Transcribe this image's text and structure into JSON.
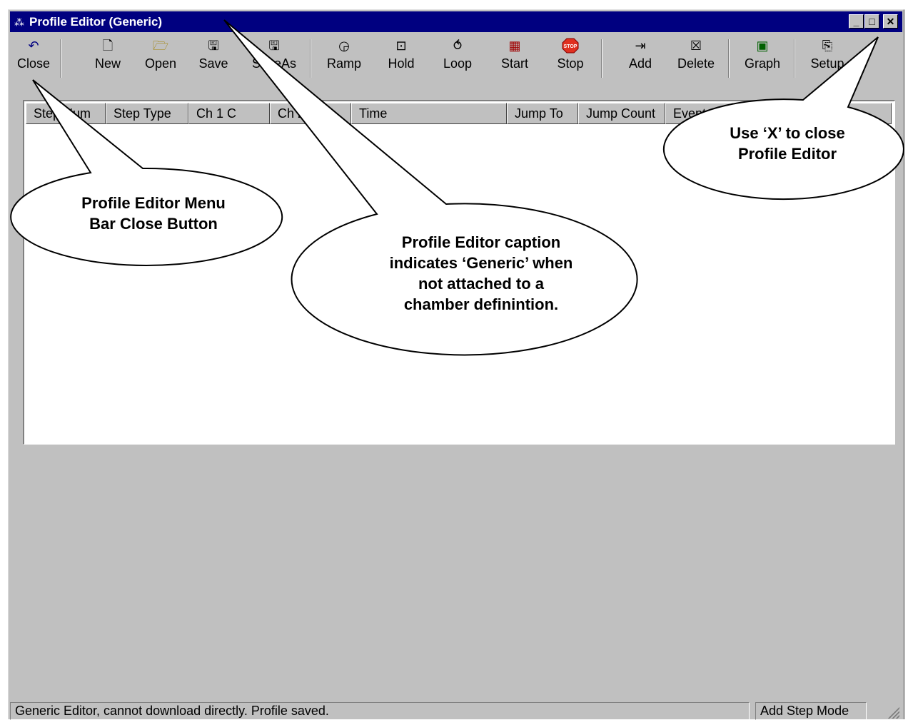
{
  "window": {
    "title": "Profile Editor (Generic)",
    "minimize_glyph": "_",
    "maximize_glyph": "□",
    "close_glyph": "✕"
  },
  "toolbar": {
    "items": [
      {
        "label": "Close",
        "icon": "undo-arrow-icon"
      },
      {
        "label": "New",
        "icon": "new-file-icon"
      },
      {
        "label": "Open",
        "icon": "open-folder-icon"
      },
      {
        "label": "Save",
        "icon": "floppy-disk-icon"
      },
      {
        "label": "SaveAs",
        "icon": "floppy-disk-icon"
      },
      {
        "label": "Ramp",
        "icon": "ramp-icon"
      },
      {
        "label": "Hold",
        "icon": "hold-icon"
      },
      {
        "label": "Loop",
        "icon": "loop-icon"
      },
      {
        "label": "Start",
        "icon": "start-icon"
      },
      {
        "label": "Stop",
        "icon": "stop-sign-icon"
      },
      {
        "label": "Add",
        "icon": "add-step-icon"
      },
      {
        "label": "Delete",
        "icon": "delete-icon"
      },
      {
        "label": "Graph",
        "icon": "graph-icon"
      },
      {
        "label": "Setup",
        "icon": "setup-icon"
      }
    ]
  },
  "table": {
    "columns": [
      "Step Num",
      "Step Type",
      "Ch 1 C",
      "Ch 2 %",
      "Time",
      "Jump To",
      "Jump Count",
      "Events",
      ""
    ]
  },
  "status": {
    "message": "Generic Editor, cannot download directly.  Profile saved.",
    "mode": "Add Step Mode"
  },
  "callouts": {
    "close_button": [
      "Profile Editor Menu",
      "Bar Close Button"
    ],
    "caption": [
      "Profile Editor caption",
      "indicates ‘Generic’ when",
      "not attached to a",
      "chamber definintion."
    ],
    "x_close": [
      "Use ‘X’ to close",
      "Profile Editor"
    ]
  },
  "colors": {
    "titlebar": "#000080",
    "face": "#c0c0c0",
    "stop_red": "#e03020"
  }
}
